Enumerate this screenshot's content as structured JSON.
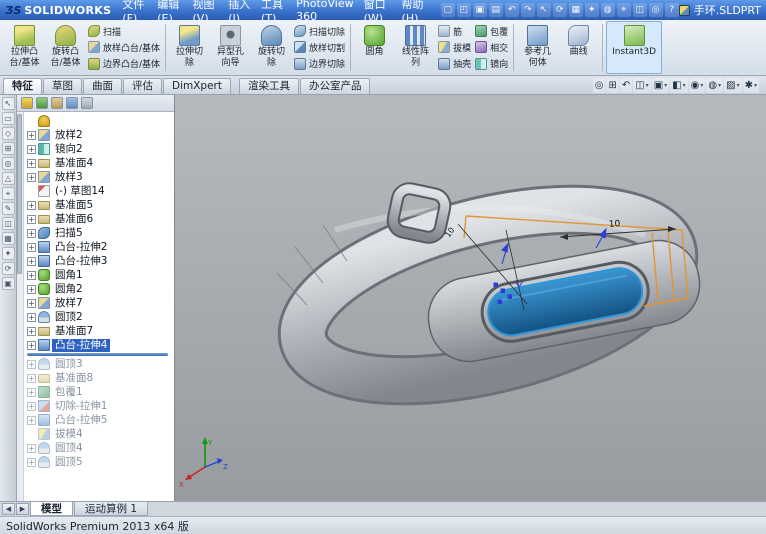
{
  "colors": {
    "titlebar_blue": "#3a72cc",
    "selection_blue": "#2f63c0",
    "screen_blue": "#1b6fae",
    "sketch_orange": "#e2952f",
    "band_gray": "#aeb3b9"
  },
  "titlebar": {
    "logo_mark": "ƷS",
    "app_name": "SOLIDWORKS",
    "menus": [
      {
        "label": "文件(F)"
      },
      {
        "label": "编辑(E)"
      },
      {
        "label": "视图(V)"
      },
      {
        "label": "插入(I)"
      },
      {
        "label": "工具(T)"
      },
      {
        "label": "PhotoView 360"
      },
      {
        "label": "窗口(W)"
      },
      {
        "label": "帮助(H)"
      }
    ],
    "tools": [
      {
        "name": "new-icon",
        "glyph": "▢"
      },
      {
        "name": "open-icon",
        "glyph": "◰"
      },
      {
        "name": "save-icon",
        "glyph": "▣"
      },
      {
        "name": "print-icon",
        "glyph": "▤"
      },
      {
        "name": "undo-icon",
        "glyph": "↶"
      },
      {
        "name": "redo-icon",
        "glyph": "↷"
      },
      {
        "name": "select-icon",
        "glyph": "↖"
      },
      {
        "name": "rebuild-icon",
        "glyph": "⟳"
      },
      {
        "name": "file-properties-icon",
        "glyph": "▦"
      },
      {
        "name": "options-icon",
        "glyph": "✦"
      },
      {
        "name": "edit-color-icon",
        "glyph": "◍"
      },
      {
        "name": "measure-icon",
        "glyph": "⌖"
      },
      {
        "name": "section-icon",
        "glyph": "◫"
      },
      {
        "name": "zoom-icon",
        "glyph": "◎"
      },
      {
        "name": "help-icon",
        "glyph": "?"
      }
    ],
    "doc_name": "手环.SLDPRT"
  },
  "glyphs": {
    "caret": "▾",
    "plus": "+"
  },
  "ribbon": {
    "large": [
      {
        "l1": "拉伸凸",
        "l2": "台/基体"
      },
      {
        "l1": "旋转凸",
        "l2": "台/基体"
      },
      {
        "l1": "拉伸切",
        "l2": "除"
      },
      {
        "l1": "异型孔",
        "l2": "向导"
      },
      {
        "l1": "旋转切",
        "l2": "除"
      },
      {
        "l1": "圆角",
        "l2": ""
      },
      {
        "l1": "线性阵",
        "l2": "列"
      },
      {
        "l1": "参考几",
        "l2": "何体"
      },
      {
        "l1": "曲线",
        "l2": ""
      },
      {
        "l1": "Instant3D",
        "l2": ""
      }
    ],
    "small": [
      {
        "label": "扫描"
      },
      {
        "label": "放样凸台/基体"
      },
      {
        "label": "边界凸台/基体"
      },
      {
        "label": "扫描切除"
      },
      {
        "label": "放样切割"
      },
      {
        "label": "边界切除"
      },
      {
        "label": "筋"
      },
      {
        "label": "拔模"
      },
      {
        "label": "抽壳"
      },
      {
        "label": "包覆"
      },
      {
        "label": "相交"
      },
      {
        "label": "镜向"
      }
    ]
  },
  "tabs": [
    {
      "label": "特征"
    },
    {
      "label": "草图"
    },
    {
      "label": "曲面"
    },
    {
      "label": "评估"
    },
    {
      "label": "DimXpert"
    },
    {
      "label": "渲染工具"
    },
    {
      "label": "办公室产品"
    }
  ],
  "headsup": [
    {
      "name": "zoom-fit",
      "glyph": "◎"
    },
    {
      "name": "zoom-area",
      "glyph": "⊞"
    },
    {
      "name": "previous-view",
      "glyph": "↶"
    },
    {
      "name": "section-view",
      "glyph": "◫"
    },
    {
      "name": "view-orientation",
      "glyph": "▣"
    },
    {
      "name": "display-style",
      "glyph": "◧"
    },
    {
      "name": "hide-show-items",
      "glyph": "◉"
    },
    {
      "name": "edit-appearance",
      "glyph": "◍"
    },
    {
      "name": "apply-scene",
      "glyph": "▨"
    },
    {
      "name": "view-settings",
      "glyph": "✱"
    }
  ],
  "left_toolbar": [
    {
      "glyph": "↖"
    },
    {
      "glyph": "▭"
    },
    {
      "glyph": "◇"
    },
    {
      "glyph": "⊞"
    },
    {
      "glyph": "◎"
    },
    {
      "glyph": "△"
    },
    {
      "glyph": "⌖"
    },
    {
      "glyph": "✎"
    },
    {
      "glyph": "◫"
    },
    {
      "glyph": "▦"
    },
    {
      "glyph": "✦"
    },
    {
      "glyph": "⟳"
    },
    {
      "glyph": "▣"
    }
  ],
  "tree": {
    "items": [
      {
        "label": "",
        "icon": "bell"
      },
      {
        "label": "放样2",
        "icon": "loft"
      },
      {
        "label": "镜向2",
        "icon": "mirror"
      },
      {
        "label": "基准面4",
        "icon": "plane"
      },
      {
        "label": "放样3",
        "icon": "loft"
      },
      {
        "label": "(-) 草图14",
        "icon": "sketch"
      },
      {
        "label": "基准面5",
        "icon": "plane"
      },
      {
        "label": "基准面6",
        "icon": "plane"
      },
      {
        "label": "扫描5",
        "icon": "sweep"
      },
      {
        "label": "凸台-拉伸2",
        "icon": "boss"
      },
      {
        "label": "凸台-拉伸3",
        "icon": "boss"
      },
      {
        "label": "圆角1",
        "icon": "fillet"
      },
      {
        "label": "圆角2",
        "icon": "fillet"
      },
      {
        "label": "放样7",
        "icon": "loft"
      },
      {
        "label": "圆顶2",
        "icon": "dome"
      },
      {
        "label": "基准面7",
        "icon": "plane"
      },
      {
        "label": "凸台-拉伸4",
        "icon": "boss",
        "state": "selected"
      },
      {
        "label": "圆顶3",
        "icon": "dome",
        "state": "dim"
      },
      {
        "label": "基准面8",
        "icon": "plane",
        "state": "dim"
      },
      {
        "label": "包覆1",
        "icon": "wrap",
        "state": "dim"
      },
      {
        "label": "切除-拉伸1",
        "icon": "cut",
        "state": "dim"
      },
      {
        "label": "凸台-拉伸5",
        "icon": "boss",
        "state": "dim"
      },
      {
        "label": "拔模4",
        "icon": "draft",
        "state": "dim"
      },
      {
        "label": "圆顶4",
        "icon": "dome",
        "state": "dim"
      },
      {
        "label": "圆顶5",
        "icon": "dome",
        "state": "dim"
      }
    ]
  },
  "viewport": {
    "dim_top": "10",
    "dim_left": "10",
    "triad": {
      "x": "X",
      "y": "Y",
      "z": "Z"
    }
  },
  "bottom": {
    "nav": [
      {
        "name": "scroll-left",
        "glyph": "◀"
      },
      {
        "name": "scroll-right",
        "glyph": "▶"
      }
    ],
    "tabs": [
      {
        "label": "模型"
      },
      {
        "label": "运动算例 1"
      }
    ]
  },
  "statusbar": {
    "text": "SolidWorks Premium 2013 x64 版"
  }
}
